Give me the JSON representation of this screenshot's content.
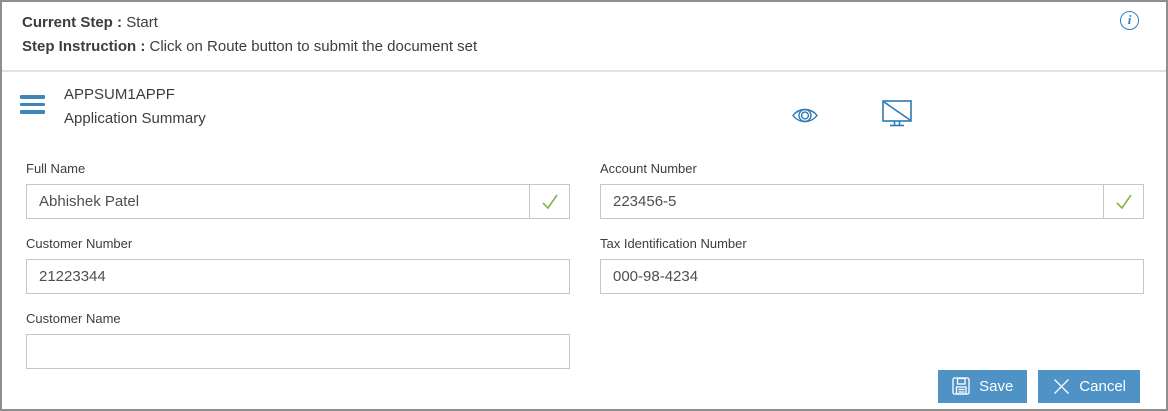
{
  "status_bar": {
    "current_step_label": "Current Step :",
    "current_step_value": "Start",
    "instruction_label": "Step Instruction :",
    "instruction_value": "Click on Route button to submit the document set",
    "info_icon": "info-circle",
    "info_glyph": "i"
  },
  "header": {
    "menu_icon": "hamburger-menu",
    "title": "APPSUM1APPF",
    "subtitle": "Application Summary",
    "preview_icon": "eye",
    "display_icon": "monitor-diagonal"
  },
  "form": {
    "fields": [
      {
        "label": "Full Name",
        "value": "Abhishek Patel",
        "validated": true,
        "valid_icon": "green-check"
      },
      {
        "label": "Account Number",
        "value": "223456-5",
        "validated": true,
        "valid_icon": "green-check"
      },
      {
        "label": "Customer Number",
        "value": "21223344",
        "validated": false
      },
      {
        "label": "Tax Identification Number",
        "value": "000-98-4234",
        "validated": false
      },
      {
        "label": "Customer Name",
        "value": "",
        "validated": false
      }
    ]
  },
  "actions": {
    "save_label": "Save",
    "save_icon": "floppy-disk",
    "cancel_label": "Cancel",
    "cancel_icon": "x-mark"
  },
  "colors": {
    "button_blue": "#4f93c6",
    "icon_blue": "#2e7ab3",
    "check_green": "#82b54b",
    "border_gray": "#c6c6c6"
  }
}
